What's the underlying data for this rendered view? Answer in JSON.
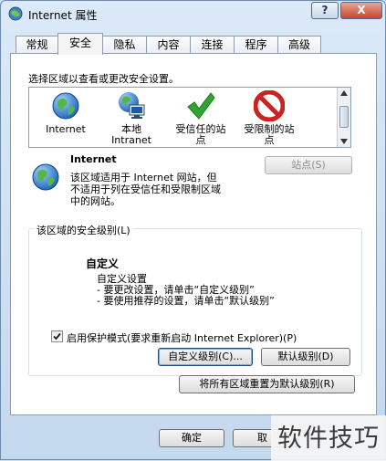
{
  "window": {
    "title": "Internet 属性",
    "help_label": "?",
    "close_label": "X"
  },
  "tabs": [
    {
      "label": "常规"
    },
    {
      "label": "安全",
      "active": true
    },
    {
      "label": "隐私"
    },
    {
      "label": "内容"
    },
    {
      "label": "连接"
    },
    {
      "label": "程序"
    },
    {
      "label": "高级"
    }
  ],
  "zone_list": {
    "heading": "选择区域以查看或更改安全设置。",
    "items": [
      {
        "line1": "Internet",
        "line2": "",
        "icon": "globe-icon"
      },
      {
        "line1": "本地",
        "line2": "Intranet",
        "icon": "local-intranet-icon"
      },
      {
        "line1": "受信任的站",
        "line2": "点",
        "icon": "green-check-icon"
      },
      {
        "line1": "受限制的站",
        "line2": "点",
        "icon": "restricted-icon"
      }
    ]
  },
  "zone_detail": {
    "name": "Internet",
    "sites_button": "站点(S)",
    "description_line1": "该区域适用于 Internet 网站，但",
    "description_line2": "不适用于列在受信任和受限制区域",
    "description_line3": "中的网站。"
  },
  "security_level": {
    "group_label": "该区域的安全级别(L)",
    "level_name": "自定义",
    "setting_title": "自定义设置",
    "hint_line1": "- 要更改设置，请单击“自定义级别”",
    "hint_line2": "- 要使用推荐的设置，请单击“默认级别”",
    "protected_mode_label": "启用保护模式(要求重新启动 Internet Explorer)(P)",
    "protected_mode_checked": true,
    "custom_level_button": "自定义级别(C)...",
    "default_level_button": "默认级别(D)",
    "reset_all_button": "将所有区域重置为默认级别(R)"
  },
  "footer": {
    "ok_button": "确定",
    "cancel_button_partial": "取"
  },
  "watermark": {
    "text": "软件技巧"
  },
  "colors": {
    "panel_bg": "#ffffff",
    "frame_bg": "#cfe0f2",
    "close_red": "#c8462c",
    "check_green": "#2fa52f",
    "restricted_red": "#cc2222"
  }
}
